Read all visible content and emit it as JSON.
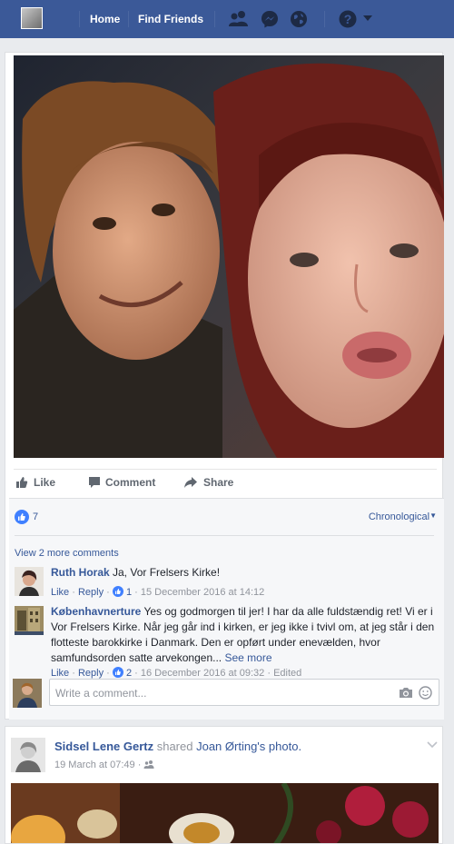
{
  "topbar": {
    "home_label": "Home",
    "find_friends_label": "Find Friends",
    "icons": [
      "friend-requests-icon",
      "messages-icon",
      "notifications-globe-icon",
      "help-icon",
      "account-menu-chevron-icon"
    ],
    "color": "#3b5998"
  },
  "post": {
    "actions": {
      "like": "Like",
      "comment": "Comment",
      "share": "Share"
    },
    "reactions_count": "7",
    "sort_label": "Chronological",
    "view_more": "View 2 more comments",
    "comments": [
      {
        "author": "Ruth Horak",
        "text": " Ja, Vor Frelsers Kirke!",
        "like": "Like",
        "reply": "Reply",
        "reactions": "1",
        "timestamp": "15 December 2016 at 14:12"
      },
      {
        "author": "Københavnerture",
        "text_line1": " Yes og godmorgen til jer! I har da alle fuldstændig ret! Vi er i",
        "text_line2": "Vor Frelsers Kirke. Når jeg går ind i kirken, er jeg ikke i tvivl om, at jeg står i den",
        "text_line3": "flotteste barokkirke i Danmark. Den er opført under enevælden, hvor",
        "text_line4": "samfundsorden satte arvekongen...",
        "see_more": "See more",
        "like": "Like",
        "reply": "Reply",
        "reactions": "2",
        "timestamp": "16 December 2016 at 09:32",
        "edited": "Edited"
      }
    ],
    "composer_placeholder": "Write a comment..."
  },
  "post2": {
    "author": "Sidsel Lene Gertz",
    "shared_text": "shared",
    "source": "Joan Ørting's",
    "object": "photo.",
    "timestamp": "19 March at 07:49"
  },
  "colors": {
    "link": "#365899",
    "meta": "#90949c",
    "brand": "#3b5998"
  }
}
